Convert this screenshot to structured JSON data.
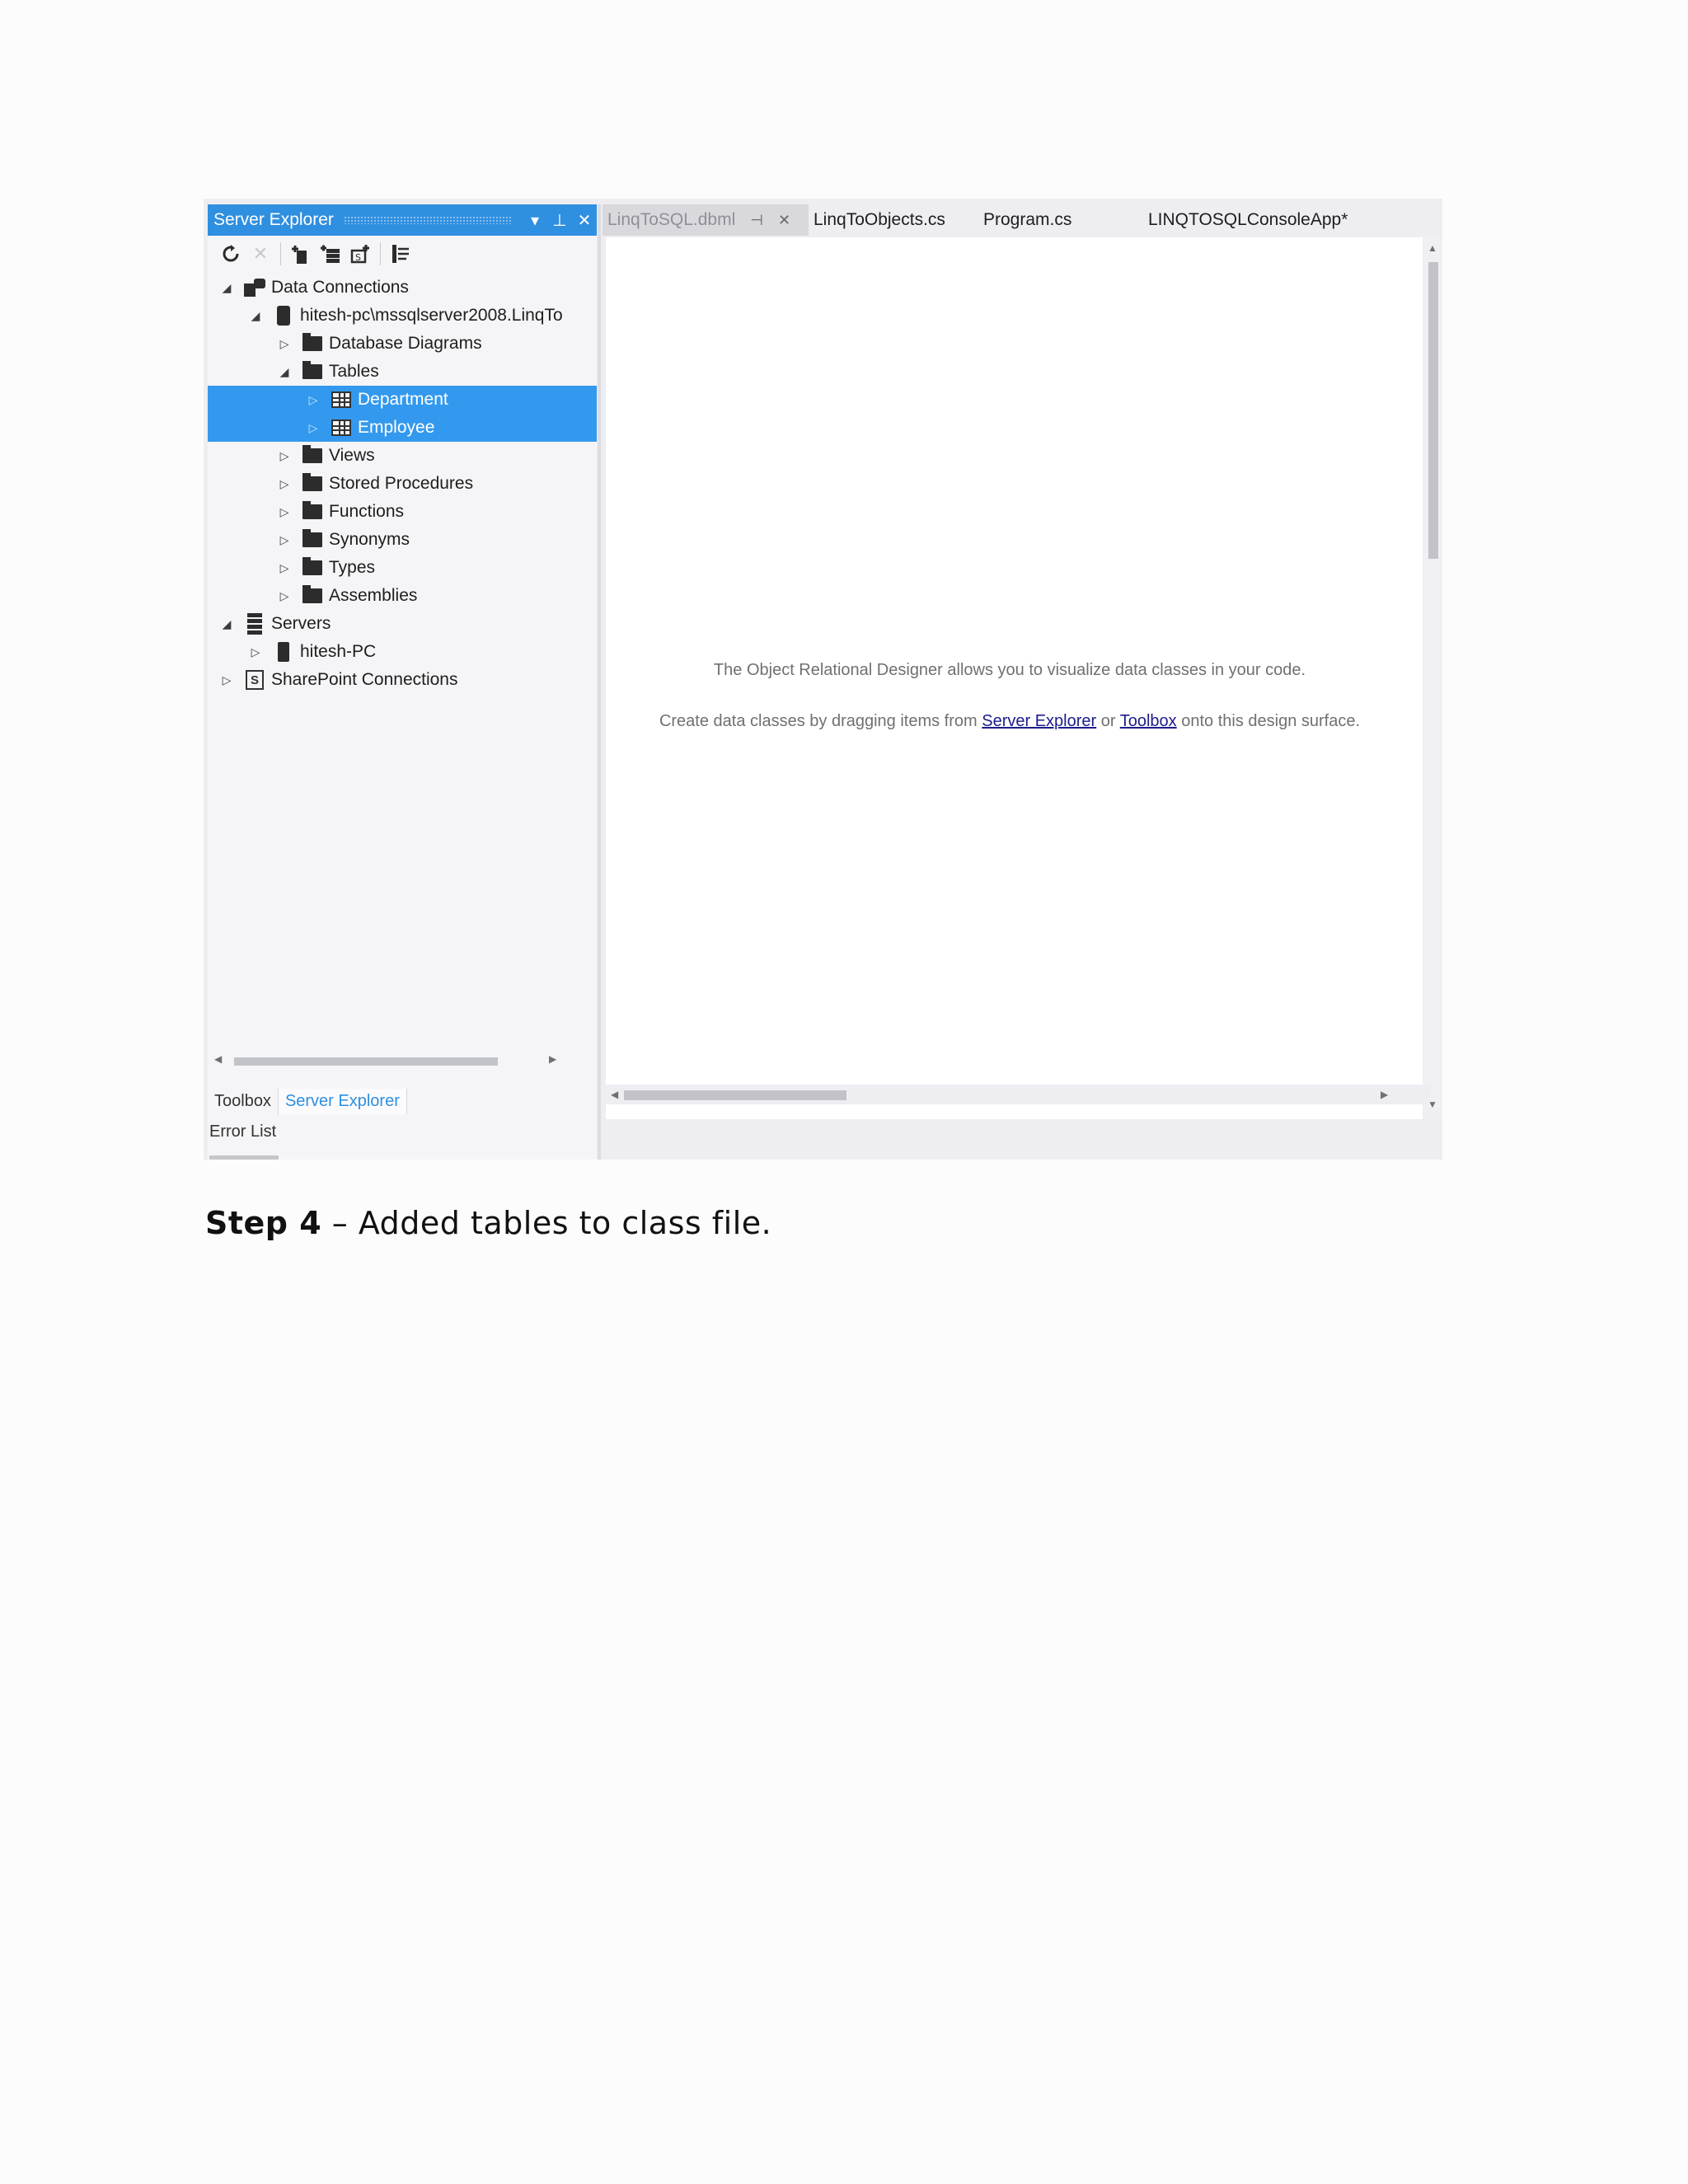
{
  "server_explorer": {
    "title": "Server Explorer",
    "title_buttons": [
      "▾",
      "⊥",
      "✕"
    ],
    "toolbar_icons": [
      "refresh-icon",
      "stop-icon",
      "connect-to-database-icon",
      "connect-to-server-icon",
      "connect-to-sharepoint-icon",
      "properties-icon"
    ],
    "tree": [
      {
        "label": "Data Connections",
        "level": 0,
        "arrow": "◢",
        "icon": "data-connections-icon"
      },
      {
        "label": "hitesh-pc\\mssqlserver2008.LinqTo",
        "level": 1,
        "arrow": "◢",
        "icon": "database-icon"
      },
      {
        "label": "Database Diagrams",
        "level": 2,
        "arrow": "▷",
        "icon": "folder-icon"
      },
      {
        "label": "Tables",
        "level": 2,
        "arrow": "◢",
        "icon": "folder-icon"
      },
      {
        "label": "Department",
        "level": 3,
        "arrow": "▷",
        "icon": "table-icon",
        "selected": true
      },
      {
        "label": "Employee",
        "level": 3,
        "arrow": "▷",
        "icon": "table-icon",
        "selected": true
      },
      {
        "label": "Views",
        "level": 2,
        "arrow": "▷",
        "icon": "folder-icon"
      },
      {
        "label": "Stored Procedures",
        "level": 2,
        "arrow": "▷",
        "icon": "folder-icon"
      },
      {
        "label": "Functions",
        "level": 2,
        "arrow": "▷",
        "icon": "folder-icon"
      },
      {
        "label": "Synonyms",
        "level": 2,
        "arrow": "▷",
        "icon": "folder-icon"
      },
      {
        "label": "Types",
        "level": 2,
        "arrow": "▷",
        "icon": "folder-icon"
      },
      {
        "label": "Assemblies",
        "level": 2,
        "arrow": "▷",
        "icon": "folder-icon"
      },
      {
        "label": "Servers",
        "level": 0,
        "arrow": "◢",
        "icon": "servers-icon"
      },
      {
        "label": "hitesh-PC",
        "level": 1,
        "arrow": "▷",
        "icon": "computer-icon"
      },
      {
        "label": "SharePoint Connections",
        "level": 0,
        "arrow": "▷",
        "icon": "sharepoint-icon"
      }
    ],
    "bottom_tabs": [
      {
        "label": "Toolbox",
        "active": false
      },
      {
        "label": "Server Explorer",
        "active": true
      }
    ],
    "error_list": "Error List"
  },
  "document_tabs": [
    {
      "label": "LinqToSQL.dbml",
      "active": true,
      "pin": "⊣",
      "close": "✕"
    },
    {
      "label": "LinqToObjects.cs",
      "active": false
    },
    {
      "label": "Program.cs",
      "active": false
    },
    {
      "label": "LINQTOSQLConsoleApp*",
      "active": false
    }
  ],
  "designer": {
    "message_line1": "The Object Relational Designer allows you to visualize data classes in your code.",
    "message_prefix": "Create data classes by dragging items from ",
    "link_server_explorer": "Server Explorer",
    "message_or": " or ",
    "link_toolbox": "Toolbox",
    "message_suffix": " onto this design surface."
  },
  "caption": {
    "step": "Step 4",
    "text": " – Added tables to class file."
  },
  "colors": {
    "accent": "#2f8fe0",
    "selection": "#3399ee"
  }
}
